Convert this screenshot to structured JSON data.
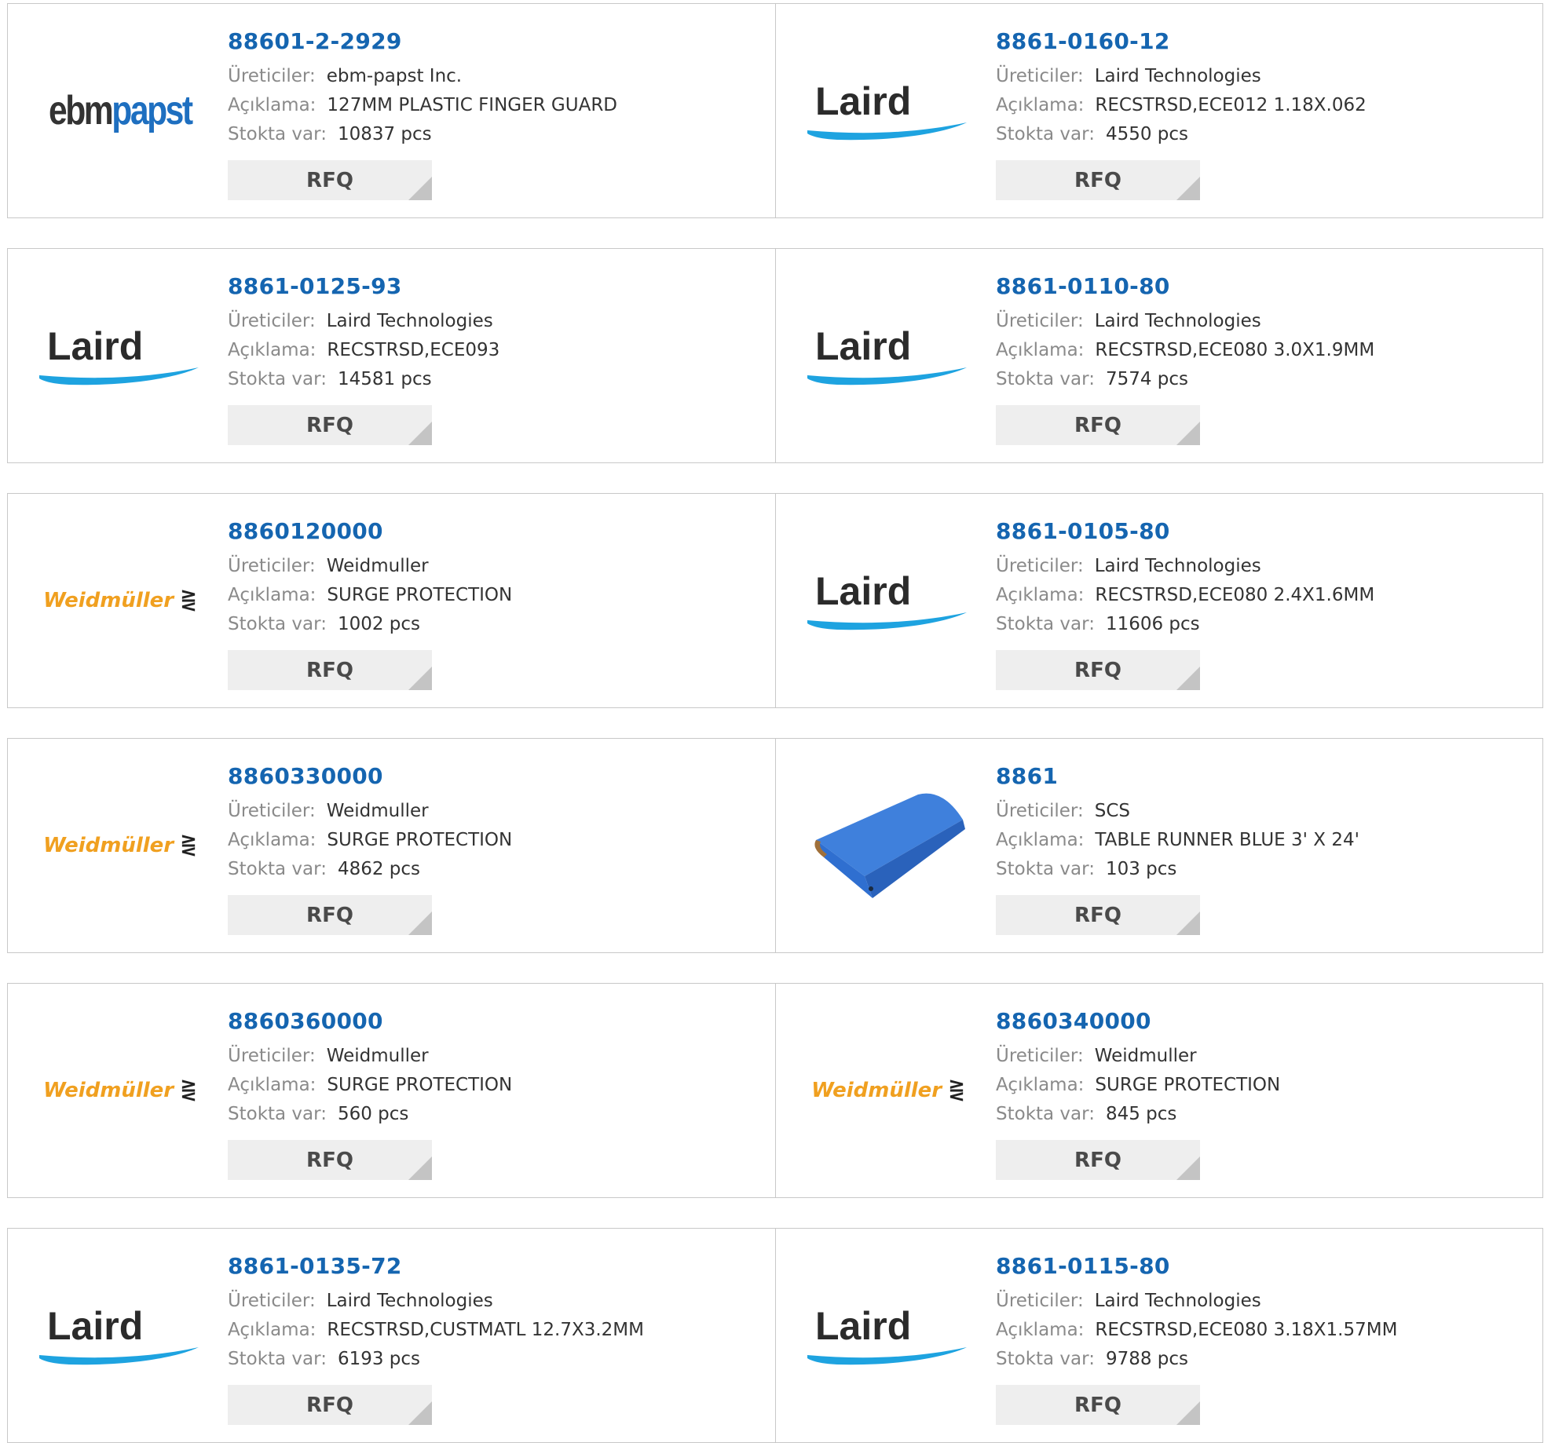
{
  "labels": {
    "manufacturer": "Üreticiler:",
    "description": "Açıklama:",
    "stock": "Stokta var:",
    "rfq": "RFQ"
  },
  "colors": {
    "part_link": "#1565b0",
    "label": "#8a8a8a",
    "value": "#333333",
    "rfq_bg": "#eeeeee",
    "laird_swoosh": "#1ea3e0",
    "weidmuller_orange": "#f0a020",
    "scs_mat": "#2f6fd0"
  },
  "products": [
    {
      "part": "88601-2-2929",
      "manufacturer": "ebm-papst Inc.",
      "description": "127MM PLASTIC FINGER GUARD",
      "stock": "10837 pcs",
      "logo": "ebmpapst",
      "logo_text_a": "ebm",
      "logo_text_b": "papst"
    },
    {
      "part": "8861-0160-12",
      "manufacturer": "Laird Technologies",
      "description": "RECSTRSD,ECE012 1.18X.062",
      "stock": "4550 pcs",
      "logo": "laird",
      "logo_text": "Laird"
    },
    {
      "part": "8861-0125-93",
      "manufacturer": "Laird Technologies",
      "description": "RECSTRSD,ECE093",
      "stock": "14581 pcs",
      "logo": "laird",
      "logo_text": "Laird"
    },
    {
      "part": "8861-0110-80",
      "manufacturer": "Laird Technologies",
      "description": "RECSTRSD,ECE080 3.0X1.9MM",
      "stock": "7574 pcs",
      "logo": "laird",
      "logo_text": "Laird"
    },
    {
      "part": "8860120000",
      "manufacturer": "Weidmuller",
      "description": "SURGE PROTECTION",
      "stock": "1002 pcs",
      "logo": "weidmuller",
      "logo_text": "Weidmüller"
    },
    {
      "part": "8861-0105-80",
      "manufacturer": "Laird Technologies",
      "description": "RECSTRSD,ECE080 2.4X1.6MM",
      "stock": "11606 pcs",
      "logo": "laird",
      "logo_text": "Laird"
    },
    {
      "part": "8860330000",
      "manufacturer": "Weidmuller",
      "description": "SURGE PROTECTION",
      "stock": "4862 pcs",
      "logo": "weidmuller",
      "logo_text": "Weidmüller"
    },
    {
      "part": "8861",
      "manufacturer": "SCS",
      "description": "TABLE RUNNER BLUE 3' X 24'",
      "stock": "103 pcs",
      "logo": "scs-mat"
    },
    {
      "part": "8860360000",
      "manufacturer": "Weidmuller",
      "description": "SURGE PROTECTION",
      "stock": "560 pcs",
      "logo": "weidmuller",
      "logo_text": "Weidmüller"
    },
    {
      "part": "8860340000",
      "manufacturer": "Weidmuller",
      "description": "SURGE PROTECTION",
      "stock": "845 pcs",
      "logo": "weidmuller",
      "logo_text": "Weidmüller"
    },
    {
      "part": "8861-0135-72",
      "manufacturer": "Laird Technologies",
      "description": "RECSTRSD,CUSTMATL 12.7X3.2MM",
      "stock": "6193 pcs",
      "logo": "laird",
      "logo_text": "Laird"
    },
    {
      "part": "8861-0115-80",
      "manufacturer": "Laird Technologies",
      "description": "RECSTRSD,ECE080 3.18X1.57MM",
      "stock": "9788 pcs",
      "logo": "laird",
      "logo_text": "Laird"
    }
  ]
}
